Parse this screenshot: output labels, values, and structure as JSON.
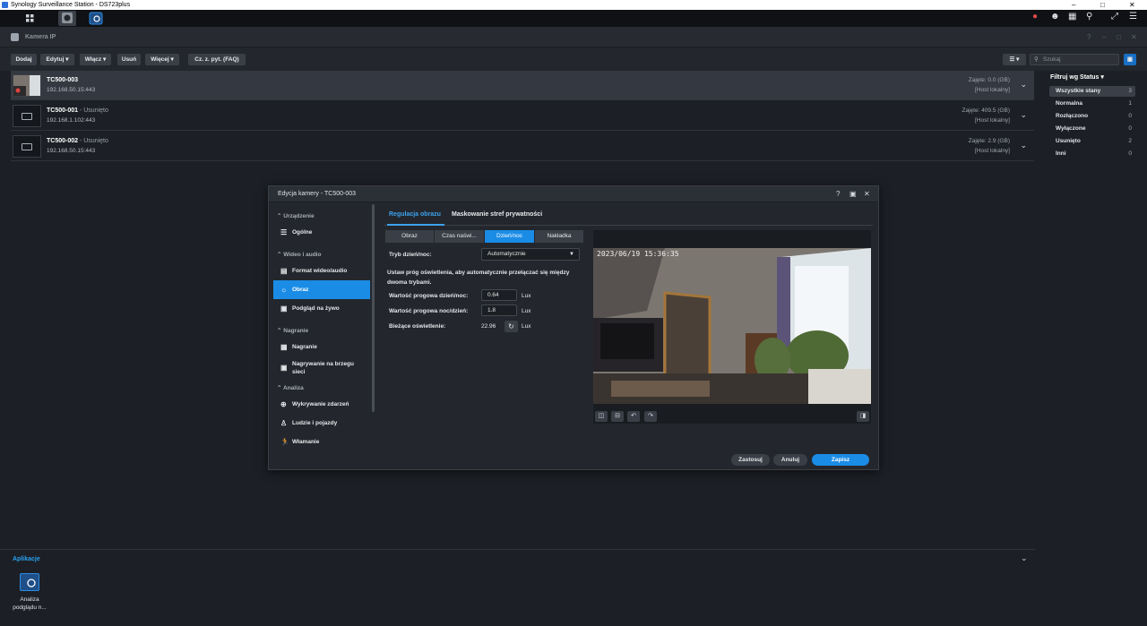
{
  "window": {
    "title": "Synology Surveillance Station - DS723plus"
  },
  "app_header": {
    "title": "Kamera IP"
  },
  "toolbar": {
    "add": "Dodaj",
    "edit": "Edytuj",
    "enable": "Włącz",
    "delete": "Usuń",
    "more": "Więcej",
    "faq": "Cz. z. pyt. (FAQ)",
    "search_placeholder": "Szukaj"
  },
  "cameras": [
    {
      "name": "TC500-003",
      "status": "",
      "ip": "192.168.50.15:443",
      "used": "Zajęte: 0.0 (GB)",
      "host": "[Host lokalny]"
    },
    {
      "name": "TC500-001",
      "status": " - Usunięto",
      "ip": "192.168.1.102:443",
      "used": "Zajęte: 409.5 (GB)",
      "host": "[Host lokalny]"
    },
    {
      "name": "TC500-002",
      "status": " - Usunięto",
      "ip": "192.168.50.15:443",
      "used": "Zajęte: 2.9 (GB)",
      "host": "[Host lokalny]"
    }
  ],
  "filter": {
    "title": "Filtruj wg Status",
    "items": [
      {
        "label": "Wszystkie stany",
        "count": "3"
      },
      {
        "label": "Normalna",
        "count": "1"
      },
      {
        "label": "Rozłączono",
        "count": "0"
      },
      {
        "label": "Wyłączone",
        "count": "0"
      },
      {
        "label": "Usunięto",
        "count": "2"
      },
      {
        "label": "Inni",
        "count": "0"
      }
    ]
  },
  "apps": {
    "title": "Aplikacje",
    "items": [
      {
        "label1": "Analiza",
        "label2": "podglądu n..."
      }
    ]
  },
  "dialog": {
    "title": "Edycja kamery - TC500-003",
    "nav": {
      "sec_device": "Urządzenie",
      "general": "Ogólne",
      "sec_av": "Wideo i audio",
      "video_format": "Format wideo/audio",
      "image": "Obraz",
      "live": "Podgląd na żywo",
      "sec_rec": "Nagranie",
      "recording": "Nagranie",
      "edge1": "Nagrywanie na brzegu",
      "edge2": "sieci",
      "sec_an": "Analiza",
      "detect": "Wykrywanie zdarzeń",
      "people": "Ludzie i pojazdy",
      "intrusion": "Włamanie"
    },
    "tabs": {
      "adjust": "Regulacja obrazu",
      "privacy": "Maskowanie stref prywatności"
    },
    "subtabs": {
      "image": "Obraz",
      "exposure": "Czas naświ...",
      "daynight": "Dzień/noc",
      "overlay": "Nakładka"
    },
    "form": {
      "mode_label": "Tryb dzień/noc:",
      "mode_value": "Automatycznie",
      "desc": "Ustaw próg oświetlenia, aby automatycznie przełączać się między dwoma trybami.",
      "dn_label": "Wartość progowa dzień/noc:",
      "dn_value": "0.64",
      "nd_label": "Wartość progowa noc/dzień:",
      "nd_value": "1.8",
      "cur_label": "Bieżące oświetlenie:",
      "cur_value": "22.96",
      "unit": "Lux"
    },
    "preview": {
      "timestamp": "2023/06/19 15:36:35"
    },
    "footer": {
      "apply": "Zastosuj",
      "cancel": "Anuluj",
      "save": "Zapisz"
    }
  },
  "colors": {
    "accent": "#1a8ce6",
    "bg": "#1c1f25",
    "link": "#2aa1f0"
  }
}
